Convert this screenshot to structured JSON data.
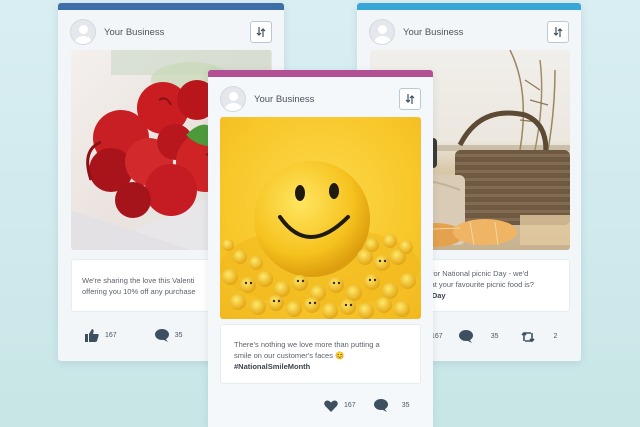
{
  "colors": {
    "left_accent": "#3d6ea8",
    "center_accent": "#b34f94",
    "right_accent": "#39a6d8",
    "icon": "#3e5060"
  },
  "cards": {
    "left": {
      "business_name": "Your Business",
      "text_line1": "We're sharing the love this Valenti",
      "text_line2": "offering you 10% off any purchase",
      "likes": "167",
      "comments": "35"
    },
    "center": {
      "business_name": "Your Business",
      "text_line1": "There's nothing we love more than putting a",
      "text_line2": "smile on our customer's faces 😊",
      "hashtag": "#NationalSmileMonth",
      "likes": "167",
      "comments": "35"
    },
    "right": {
      "business_name": "Your Business",
      "text_line1": "up for National picnic Day - we'd",
      "text_line2": "what your favourite picnic food is?",
      "hashtag": "nicDay",
      "likes": "167",
      "comments": "35",
      "retweets": "2"
    }
  },
  "icons": {
    "avatar": "user-avatar-icon",
    "sync": "sync-arrows-icon",
    "like": "thumbs-up-icon",
    "heart": "heart-icon",
    "comment": "speech-bubble-icon",
    "retweet": "retweet-icon"
  }
}
